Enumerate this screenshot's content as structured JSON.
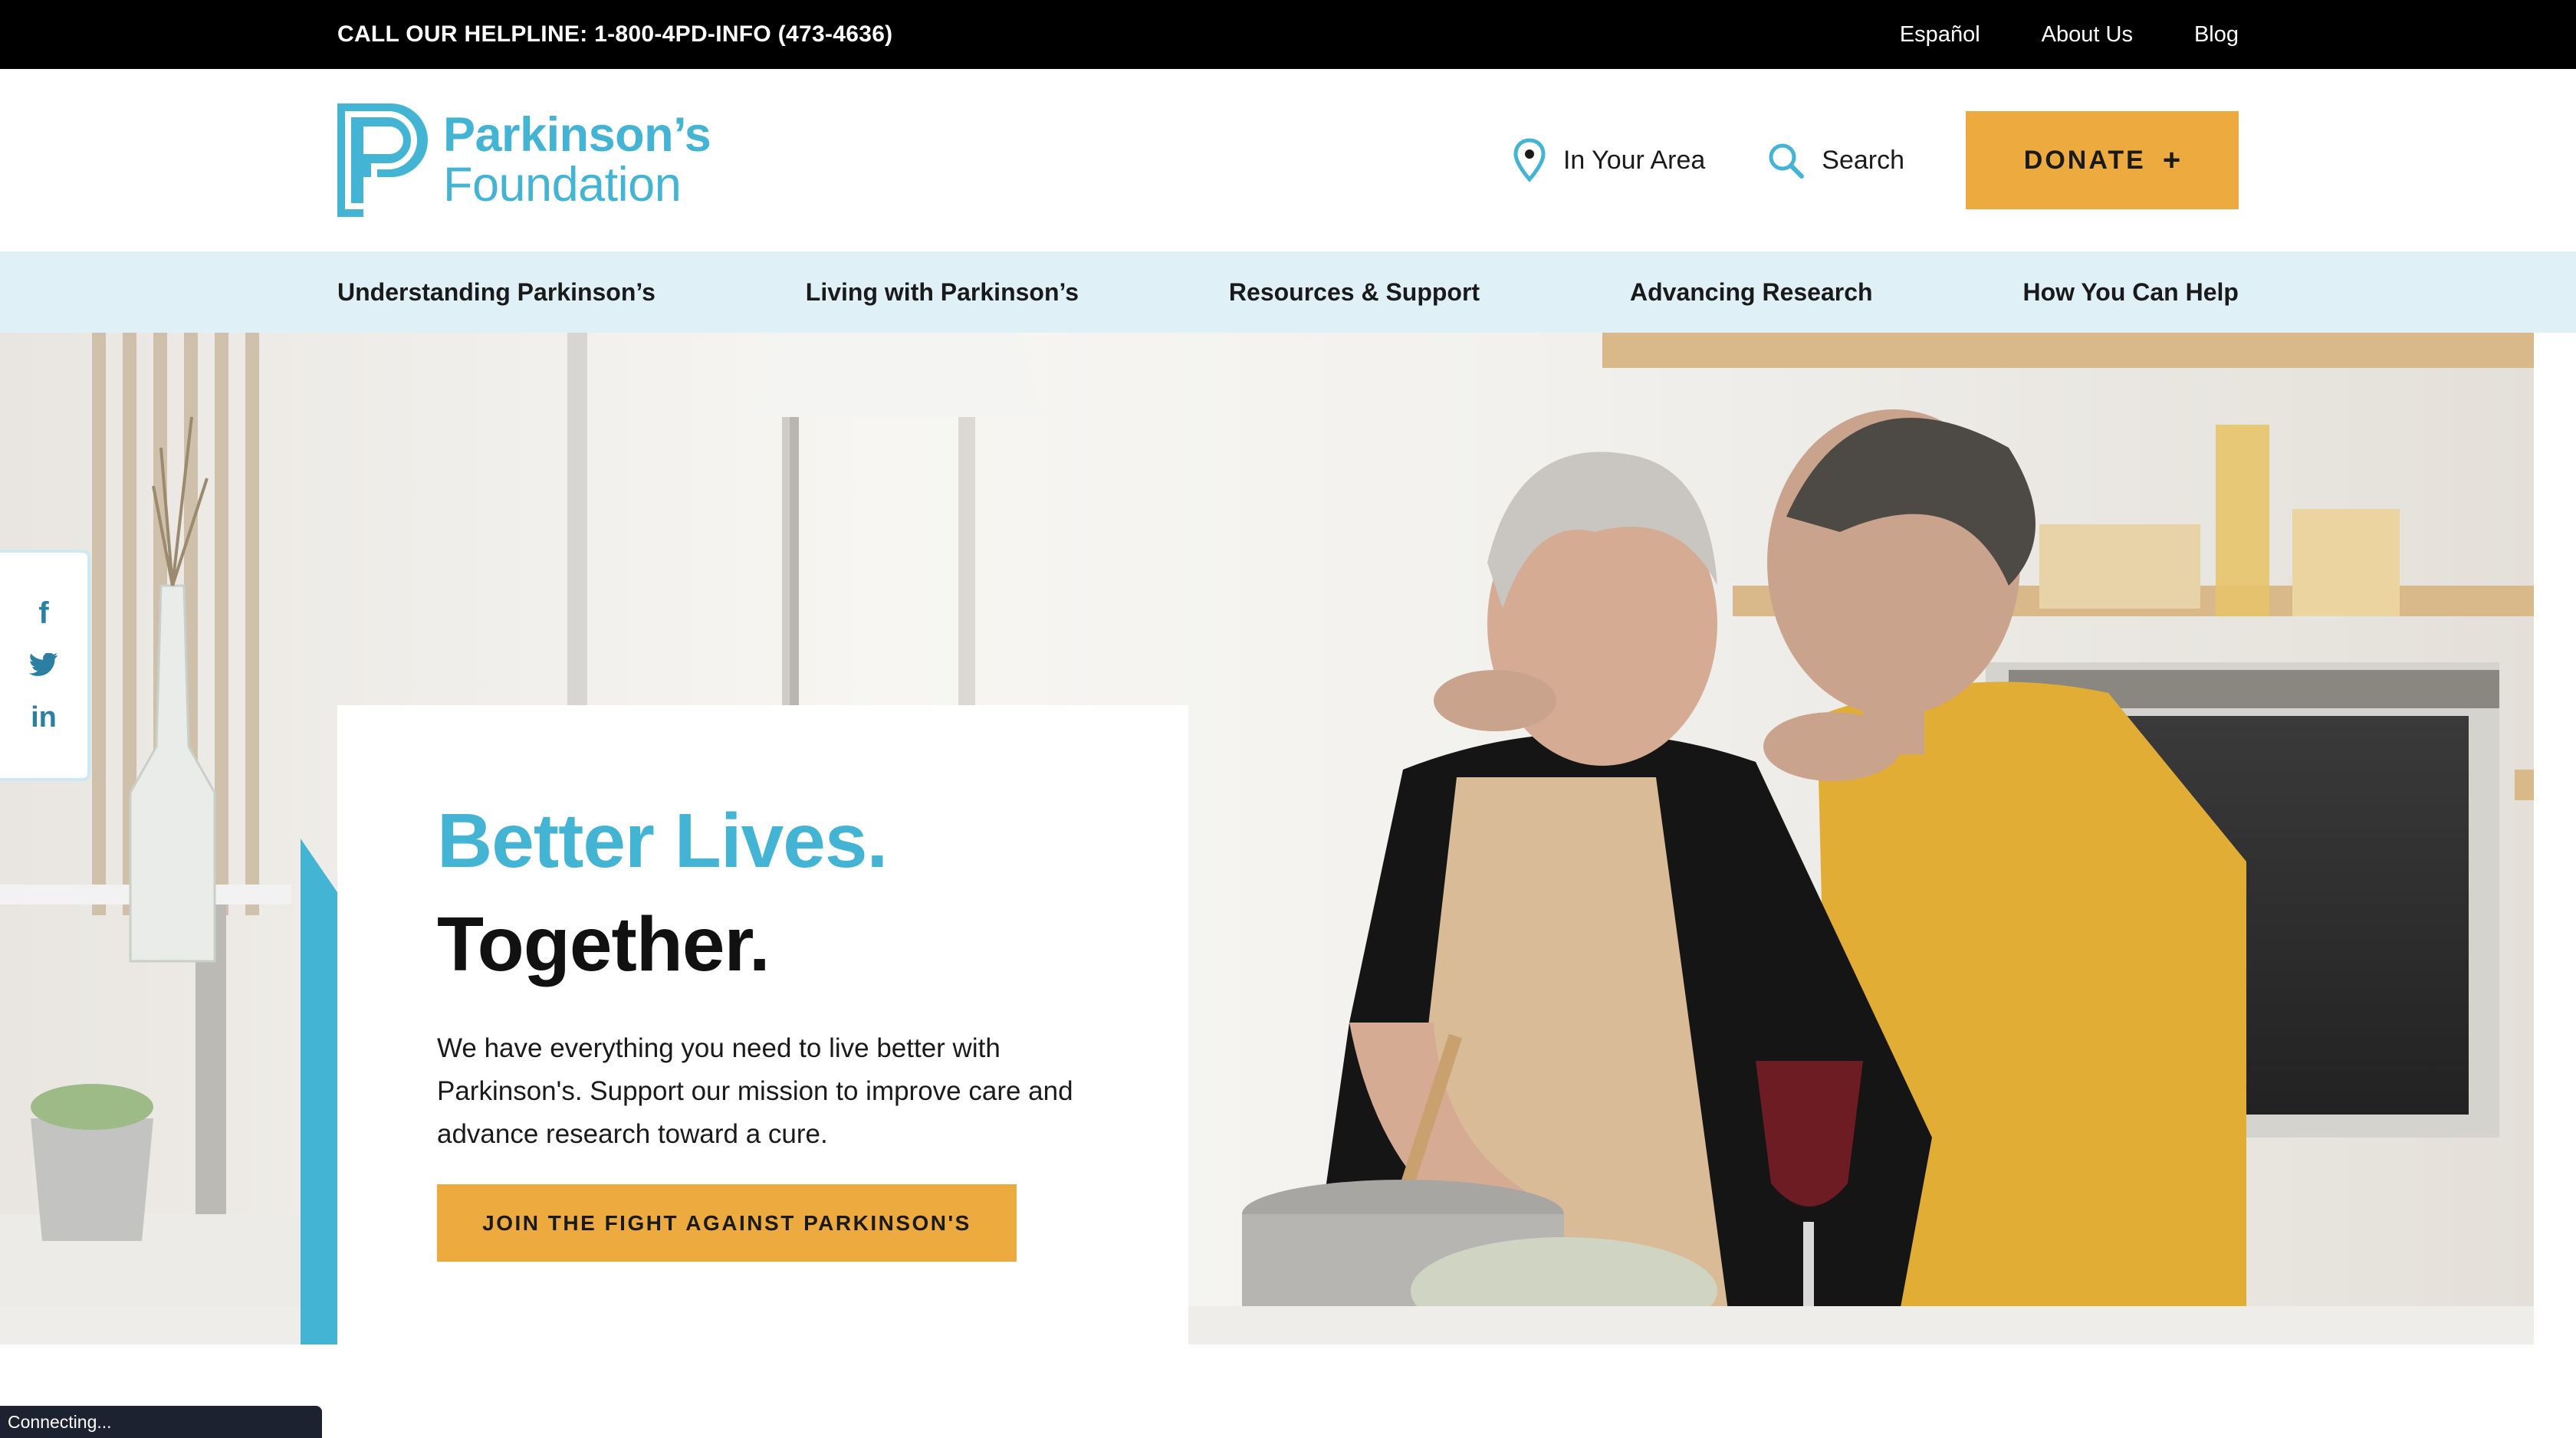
{
  "topbar": {
    "helpline": "CALL OUR HELPLINE: 1-800-4PD-INFO (473-4636)",
    "links": [
      "Español",
      "About Us",
      "Blog"
    ]
  },
  "header": {
    "logo_line1": "Parkinson’s",
    "logo_line2": "Foundation",
    "area_label": "In Your Area",
    "search_label": "Search",
    "donate_label": "DONATE",
    "donate_plus": "+"
  },
  "nav": {
    "items": [
      "Understanding Parkinson’s",
      "Living with Parkinson’s",
      "Resources & Support",
      "Advancing Research",
      "How You Can Help"
    ]
  },
  "hero": {
    "headline_line1": "Better Lives.",
    "headline_line2": "Together.",
    "body": "We have everything you need to live better with Parkinson's. Support our mission to improve care and advance research toward a cure.",
    "cta": "JOIN THE FIGHT AGAINST PARKINSON'S"
  },
  "social": {
    "facebook": "f",
    "linkedin": "in"
  },
  "status_text": "Connecting...",
  "colors": {
    "brand_blue": "#43b4d3",
    "accent_orange": "#edab3f",
    "nav_bg": "#dff1f7",
    "topbar_bg": "#000000"
  }
}
